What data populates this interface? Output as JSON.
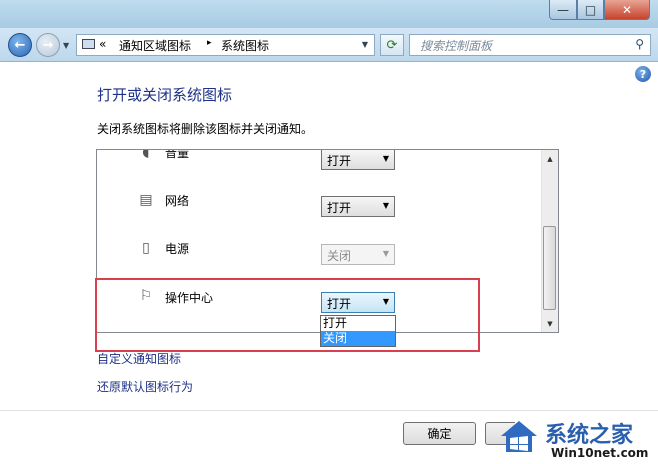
{
  "window": {
    "controls": {
      "minimize": "—",
      "maximize": "□",
      "close": "✕"
    }
  },
  "nav": {
    "breadcrumb": [
      "通知区域图标",
      "系统图标"
    ],
    "breadcrumb_overflow": "«",
    "breadcrumb_separator": "▸",
    "search_placeholder": "搜索控制面板"
  },
  "content": {
    "title": "打开或关闭系统图标",
    "description": "关闭系统图标将删除该图标并关闭通知。",
    "rows": [
      {
        "label": "音量",
        "icon": "speaker-icon",
        "value": "打开",
        "enabled": true
      },
      {
        "label": "网络",
        "icon": "network-icon",
        "value": "打开",
        "enabled": true
      },
      {
        "label": "电源",
        "icon": "power-icon",
        "value": "关闭",
        "enabled": false
      },
      {
        "label": "操作中心",
        "icon": "flag-icon",
        "value": "打开",
        "enabled": true,
        "open": true
      }
    ],
    "dropdown_options": [
      "打开",
      "关闭"
    ],
    "dropdown_selected": "关闭",
    "links": [
      "自定义通知图标",
      "还原默认图标行为"
    ]
  },
  "footer": {
    "ok_label": "确定"
  },
  "watermark": {
    "text": "系统之家",
    "url_text": "Win10net.com"
  },
  "colors": {
    "link": "#1e3287",
    "highlight_border": "#d8404e",
    "selection": "#3399ff"
  }
}
